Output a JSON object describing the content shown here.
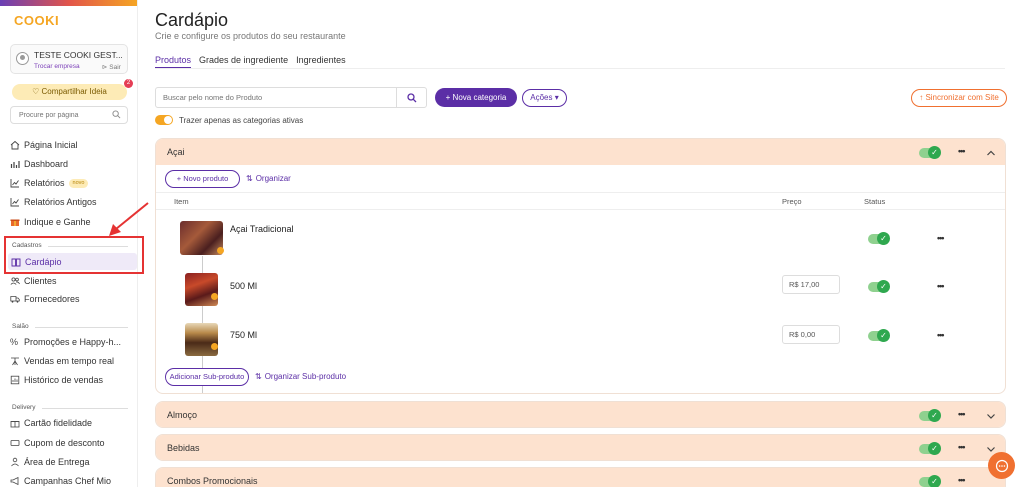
{
  "brand": {
    "logo_text": "COOKI"
  },
  "user": {
    "name": "TESTE COOKI GEST...",
    "switch_label": "Trocar empresa",
    "exit_label": "Sair"
  },
  "share": {
    "label": "Compartilhar Ideia",
    "badge": "2"
  },
  "side_search": {
    "placeholder": "Procure por página"
  },
  "sidebar": {
    "top_items": [
      {
        "label": "Página Inicial",
        "icon": "home-icon"
      },
      {
        "label": "Dashboard",
        "icon": "bar-chart-icon"
      },
      {
        "label": "Relatórios",
        "icon": "line-chart-icon",
        "badge": "novo"
      },
      {
        "label": "Relatórios Antigos",
        "icon": "line-chart-icon"
      },
      {
        "label": "Indique e Ganhe",
        "icon": "gift-icon"
      }
    ],
    "sections": [
      {
        "title": "Cadastros",
        "items": [
          {
            "label": "Cardápio",
            "icon": "book-icon",
            "active": true
          },
          {
            "label": "Clientes",
            "icon": "users-icon"
          },
          {
            "label": "Fornecedores",
            "icon": "truck-icon"
          }
        ]
      },
      {
        "title": "Salão",
        "items": [
          {
            "label": "Promoções e Happy-h...",
            "icon": "percent-icon"
          },
          {
            "label": "Vendas em tempo real",
            "icon": "broadcast-icon"
          },
          {
            "label": "Histórico de vendas",
            "icon": "history-icon"
          }
        ]
      },
      {
        "title": "Delivery",
        "items": [
          {
            "label": "Cartão fidelidade",
            "icon": "gift-card-icon"
          },
          {
            "label": "Cupom de desconto",
            "icon": "ticket-icon"
          },
          {
            "label": "Área de Entrega",
            "icon": "person-pin-icon"
          },
          {
            "label": "Campanhas Chef Mio",
            "icon": "megaphone-icon"
          }
        ]
      }
    ]
  },
  "page": {
    "title": "Cardápio",
    "subtitle": "Crie e configure os produtos do seu restaurante"
  },
  "tabs": [
    {
      "label": "Produtos",
      "active": true
    },
    {
      "label": "Grades de ingrediente",
      "active": false
    },
    {
      "label": "Ingredientes",
      "active": false
    }
  ],
  "toolbar": {
    "search_placeholder": "Buscar pelo nome do Produto",
    "new_category": "Nova categoria",
    "actions": "Ações",
    "sync": "Sincronizar com Site",
    "active_only": "Trazer apenas as categorias ativas"
  },
  "categories": [
    {
      "name": "Açai",
      "expanded": true,
      "new_product": "Novo produto",
      "organize": "Organizar",
      "columns": {
        "item": "Item",
        "price": "Preço",
        "status": "Status"
      },
      "products": [
        {
          "name": "Açai Tradicional",
          "price": "",
          "status": true
        },
        {
          "name": "500 Ml",
          "price": "R$  17,00",
          "status": true
        },
        {
          "name": "750 Ml",
          "price": "R$  0,00",
          "status": true
        }
      ],
      "add_subproduct": "Adicionar Sub-produto",
      "organize_subproduct": "Organizar Sub-produto"
    },
    {
      "name": "Almoço",
      "expanded": false
    },
    {
      "name": "Bebidas",
      "expanded": false
    },
    {
      "name": "Combos Promocionais",
      "expanded": false
    }
  ],
  "colors": {
    "brand_purple": "#5b2ea6",
    "accent_orange": "#f07030",
    "category_header": "#fde2cf",
    "status_green": "#2fa84f",
    "highlight_red": "#e53333"
  }
}
